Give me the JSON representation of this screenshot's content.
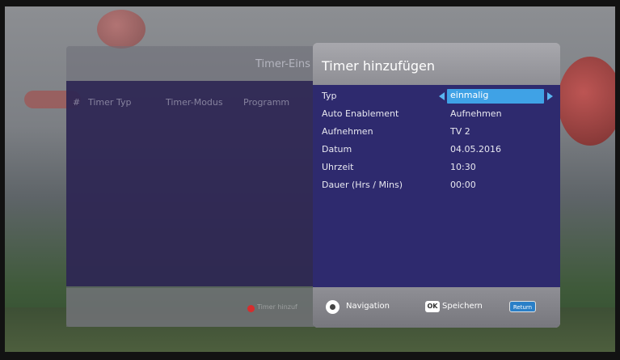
{
  "background": {
    "title": "Timer-Eins",
    "columns": [
      "#",
      "Timer Typ",
      "Timer-Modus",
      "Programm"
    ],
    "footer_hint": "Timer hinzuf"
  },
  "dialog": {
    "title": "Timer hinzufügen",
    "rows": [
      {
        "label": "Typ",
        "value": "einmalig"
      },
      {
        "label": "Auto Enablement",
        "value": "Aufnehmen"
      },
      {
        "label": "Aufnehmen",
        "value": "TV 2"
      },
      {
        "label": "Datum",
        "value": "04.05.2016"
      },
      {
        "label": "Uhrzeit",
        "value": "10:30"
      },
      {
        "label": "Dauer (Hrs / Mins)",
        "value": "00:00"
      }
    ],
    "footer": {
      "navigation_label": "Navigation",
      "ok_icon": "OK",
      "save_label": "Speichern",
      "return_icon": "Return"
    }
  },
  "colors": {
    "dialog_body": "#2e2a6e",
    "selection": "#3fa2e6",
    "header": "#9b9ba0"
  }
}
